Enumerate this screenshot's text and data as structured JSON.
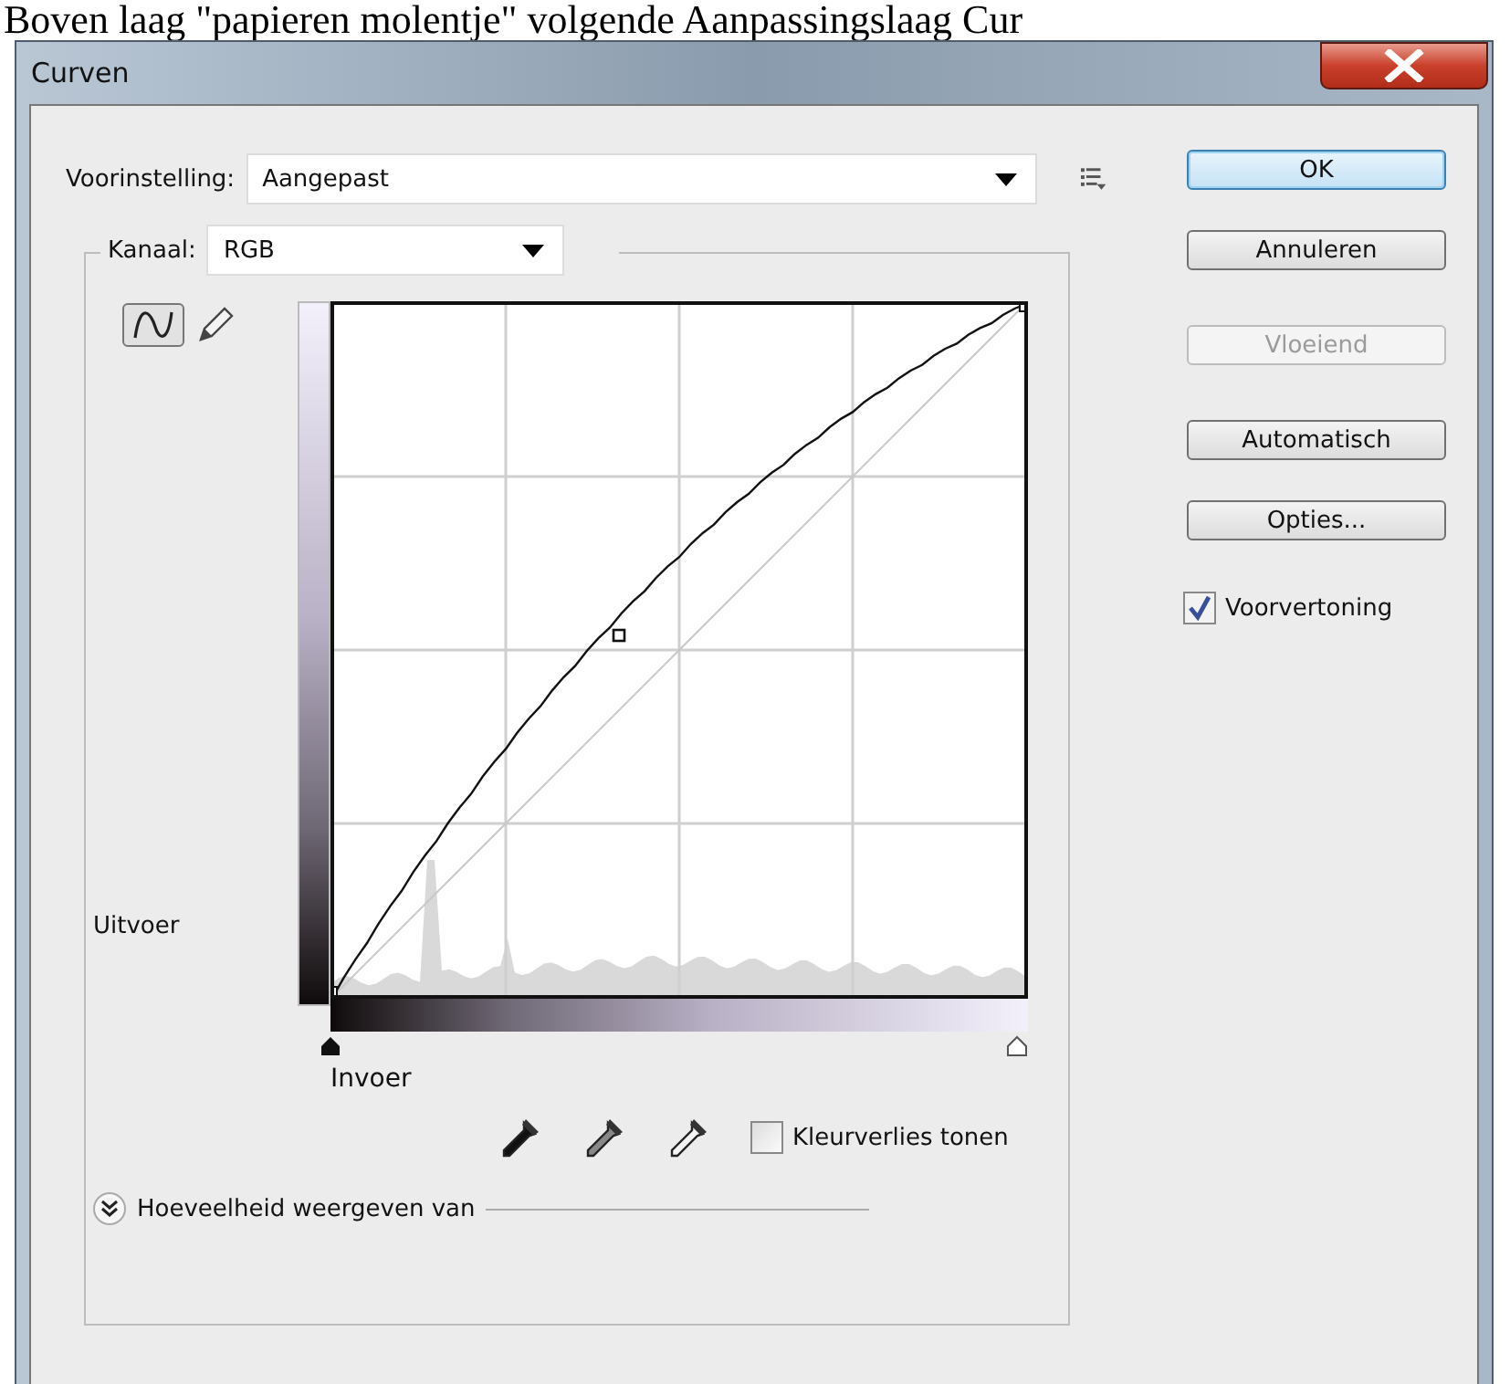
{
  "caption": "Boven laag \"papieren molentje\" volgende Aanpassingslaag Cur",
  "window": {
    "title": "Curven"
  },
  "preset": {
    "label": "Voorinstelling:",
    "value": "Aangepast"
  },
  "channel": {
    "label": "Kanaal:",
    "value": "RGB"
  },
  "tools": [
    {
      "kind": "curve",
      "selected": true
    },
    {
      "kind": "pencil",
      "selected": false
    }
  ],
  "output_label": "Uitvoer",
  "input_label": "Invoer",
  "eyedroppers": [
    {
      "kind": "black"
    },
    {
      "kind": "gray"
    },
    {
      "kind": "white"
    }
  ],
  "clipping": {
    "label": "Kleurverlies tonen",
    "checked": false
  },
  "amount": {
    "label": "Hoeveelheid weergeven van",
    "expanded": false
  },
  "buttons": [
    {
      "label": "OK",
      "default": true,
      "disabled": false
    },
    {
      "label": "Annuleren",
      "default": false,
      "disabled": false
    },
    {
      "label": "Vloeiend",
      "default": false,
      "disabled": true
    },
    {
      "label": "Automatisch",
      "default": false,
      "disabled": false
    },
    {
      "label": "Opties...",
      "default": false,
      "disabled": false
    }
  ],
  "preview": {
    "label": "Voorvertoning",
    "checked": true
  }
}
